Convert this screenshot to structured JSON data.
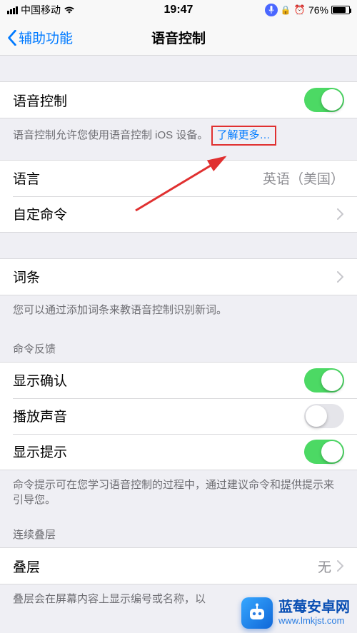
{
  "status_bar": {
    "carrier": "中国移动",
    "time": "19:47",
    "battery_pct": "76%"
  },
  "nav": {
    "back_label": "辅助功能",
    "title": "语音控制"
  },
  "main_switch": {
    "label": "语音控制",
    "on": true
  },
  "main_switch_footer": {
    "text": "语音控制允许您使用语音控制 iOS 设备。",
    "link": "了解更多…"
  },
  "lang_group": {
    "language_label": "语言",
    "language_value": "英语（美国）",
    "custom_cmd_label": "自定命令"
  },
  "vocab": {
    "label": "词条",
    "footer": "您可以通过添加词条来教语音控制识别新词。"
  },
  "feedback_header": "命令反馈",
  "feedback": {
    "confirm_label": "显示确认",
    "confirm_on": true,
    "sound_label": "播放声音",
    "sound_on": false,
    "hints_label": "显示提示",
    "hints_on": true,
    "footer": "命令提示可在您学习语音控制的过程中，通过建议命令和提供提示来引导您。"
  },
  "overlay_header": "连续叠层",
  "overlay": {
    "label": "叠层",
    "value": "无"
  },
  "overlay_footer": "叠层会在屏幕内容上显示编号或名称，以",
  "watermark": {
    "name_cn": "蓝莓安卓网",
    "url": "www.lmkjst.com"
  }
}
